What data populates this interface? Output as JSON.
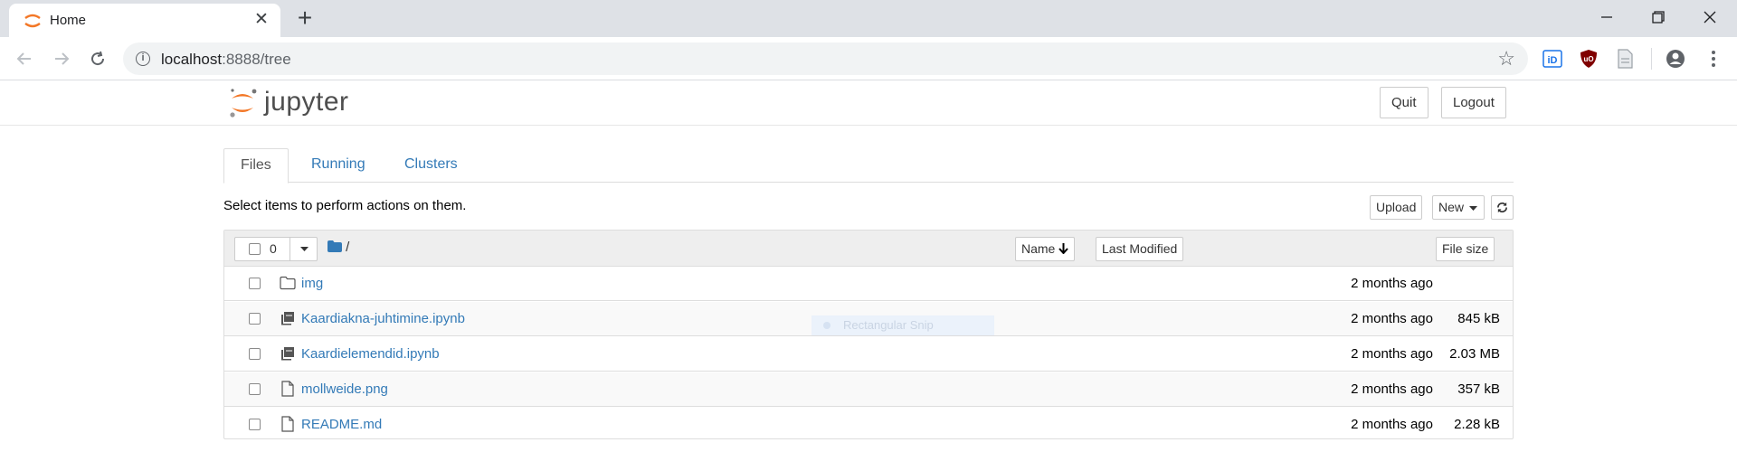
{
  "browser": {
    "tab_title": "Home",
    "url_host": "localhost",
    "url_rest": ":8888/tree",
    "close_glyph": "✕",
    "newtab_glyph": "+"
  },
  "jupyter": {
    "logo_text": "jupyter",
    "quit_label": "Quit",
    "logout_label": "Logout",
    "tabs": [
      {
        "label": "Files"
      },
      {
        "label": "Running"
      },
      {
        "label": "Clusters"
      }
    ],
    "select_message": "Select items to perform actions on them.",
    "upload_label": "Upload",
    "new_label": "New",
    "selected_count": "0",
    "breadcrumb": "/",
    "sort": {
      "name_label": "Name",
      "modified_label": "Last Modified",
      "size_label": "File size"
    },
    "files": [
      {
        "name": "img",
        "modified": "2 months ago",
        "size": "",
        "icon": "folder-icon"
      },
      {
        "name": "Kaardiakna-juhtimine.ipynb",
        "modified": "2 months ago",
        "size": "845 kB",
        "icon": "notebook-icon"
      },
      {
        "name": "Kaardielemendid.ipynb",
        "modified": "2 months ago",
        "size": "2.03 MB",
        "icon": "notebook-icon"
      },
      {
        "name": "mollweide.png",
        "modified": "2 months ago",
        "size": "357 kB",
        "icon": "file-icon"
      },
      {
        "name": "README.md",
        "modified": "2 months ago",
        "size": "2.28 kB",
        "icon": "file-icon"
      }
    ],
    "snip_overlay": "Rectangular Snip"
  },
  "colors": {
    "link": "#337ab7",
    "jupyter_orange": "#f37726",
    "chrome_bg": "#dee1e6"
  }
}
